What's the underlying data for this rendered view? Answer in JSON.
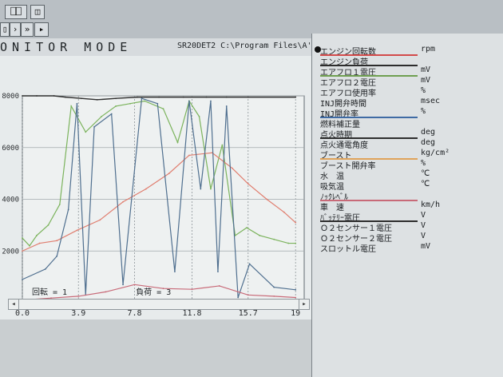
{
  "toolbar": {
    "buttons": [
      "⎕⎕",
      "◫",
      "▯",
      "›",
      "»",
      "▸"
    ]
  },
  "chart_header": {
    "mode_title": "ONITOR MODE",
    "engine_path": "SR20DET2 C:\\Program Files\\A'PEX"
  },
  "chart_data": {
    "type": "line",
    "title": "",
    "xlabel": "",
    "ylabel": "",
    "xlim": [
      0,
      19.6
    ],
    "ylim": [
      0,
      8000
    ],
    "x_ticks": [
      "0.0",
      "3.9",
      "7.8",
      "11.8",
      "15.7",
      "19"
    ],
    "y_ticks": [
      "0",
      "2000",
      "4000",
      "6000",
      "8000"
    ],
    "grid": true,
    "series": [
      {
        "name": "エンジン回転数",
        "color": "#2f2f2f",
        "x": [
          0,
          1.0,
          2.2,
          3.0,
          4.1,
          5.2,
          6.5,
          8.0,
          9.5,
          11.2,
          12.8,
          14.2,
          15.7,
          19.0
        ],
        "y": [
          8000,
          8000,
          8000,
          7950,
          7900,
          7850,
          7900,
          7950,
          7950,
          7950,
          7950,
          7950,
          7950,
          7950
        ]
      },
      {
        "name": "エアフロ1電圧",
        "color": "#7bb35c",
        "x": [
          0,
          0.5,
          1.0,
          1.8,
          2.6,
          3.4,
          4.4,
          5.5,
          6.5,
          7.5,
          8.5,
          9.8,
          10.8,
          11.6,
          12.3,
          13.1,
          13.9,
          14.8,
          15.6,
          16.5,
          17.5,
          18.5,
          19.0
        ],
        "y": [
          2500,
          2200,
          2600,
          3000,
          3800,
          7600,
          6600,
          7200,
          7600,
          7700,
          7800,
          7500,
          6200,
          7800,
          7200,
          4400,
          6100,
          2600,
          2900,
          2600,
          2450,
          2300,
          2300
        ]
      },
      {
        "name": "ブースト",
        "color": "#e07e6f",
        "x": [
          0,
          1.2,
          2.4,
          3.8,
          5.4,
          7.0,
          8.6,
          10.2,
          11.6,
          13.2,
          14.6,
          15.7,
          17.0,
          18.2,
          19.0
        ],
        "y": [
          2000,
          2300,
          2400,
          2800,
          3200,
          3900,
          4400,
          5000,
          5700,
          5800,
          5200,
          4600,
          4000,
          3500,
          3100
        ]
      },
      {
        "name": "エアフロ使用率",
        "color": "#4f6f8f",
        "x": [
          0,
          1.6,
          2.4,
          3.2,
          3.8,
          4.4,
          5.0,
          6.2,
          7.0,
          8.3,
          9.4,
          10.6,
          11.6,
          12.4,
          13.1,
          13.6,
          14.2,
          15.0,
          15.8,
          17.5,
          19.0
        ],
        "y": [
          900,
          1300,
          1800,
          3600,
          7700,
          300,
          6800,
          7300,
          700,
          7900,
          7700,
          1200,
          7800,
          4400,
          7800,
          1200,
          7600,
          200,
          1500,
          600,
          500
        ]
      },
      {
        "name": "ノックレベル",
        "color": "#c86a78",
        "x": [
          0,
          2.0,
          3.9,
          5.8,
          7.8,
          9.8,
          11.8,
          13.7,
          15.7,
          17.5,
          19.0
        ],
        "y": [
          100,
          180,
          250,
          420,
          700,
          550,
          520,
          650,
          300,
          250,
          200
        ]
      }
    ]
  },
  "chart_status": {
    "rotation_label": "回転 = 1",
    "load_label": "負荷 = 3"
  },
  "right_panel": {
    "params": [
      {
        "name": "エンジン回転数",
        "unit": "rpm",
        "line": "#d34a4a"
      },
      {
        "name": "エンジン負荷",
        "unit": "",
        "line": "#2d2d2d"
      },
      {
        "name": "エアフロ１電圧",
        "unit": "mV",
        "line": "#6f9f51"
      },
      {
        "name": "エアフロ２電圧",
        "unit": "mV",
        "line": ""
      },
      {
        "name": "エアフロ使用率",
        "unit": "%",
        "line": ""
      },
      {
        "name": "INJ開弁時間",
        "unit": "msec",
        "line": ""
      },
      {
        "name": "INJ開弁率",
        "unit": "%",
        "line": "#3f6ba4"
      },
      {
        "name": "燃料補正量",
        "unit": "",
        "line": ""
      },
      {
        "name": "点火時期",
        "unit": "deg",
        "line": "#2d2d2d"
      },
      {
        "name": "点火通電角度",
        "unit": "deg",
        "line": ""
      },
      {
        "name": "ブースト",
        "unit": "kg/cm²",
        "line": "#e0a35a"
      },
      {
        "name": "ブースト開弁率",
        "unit": "%",
        "line": ""
      },
      {
        "name": "水　温",
        "unit": "℃",
        "line": ""
      },
      {
        "name": "吸気温",
        "unit": "℃",
        "line": ""
      },
      {
        "name": "ﾉｯｸﾚﾍﾞﾙ",
        "unit": "",
        "line": "#c86a78"
      },
      {
        "name": "車　速",
        "unit": "km/h",
        "line": ""
      },
      {
        "name": "ﾊﾞｯﾃﾘｰ電圧",
        "unit": "V",
        "line": "#2d2d2d"
      },
      {
        "name": "Ｏ２センサー１電圧",
        "unit": "V",
        "line": ""
      },
      {
        "name": "Ｏ２センサー２電圧",
        "unit": "V",
        "line": ""
      },
      {
        "name": "スロットル電圧",
        "unit": "mV",
        "line": ""
      }
    ]
  }
}
